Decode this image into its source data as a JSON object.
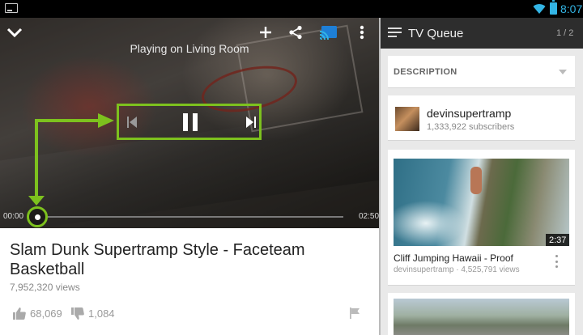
{
  "status_bar": {
    "time": "8:07",
    "accent": "#33b5e5"
  },
  "player": {
    "casting_text": "Playing on Living Room",
    "time_current": "00:00",
    "time_total": "02:50",
    "progress": 0.0,
    "annotation_color": "#7dc11e",
    "icons": {
      "collapse": "chevron-down-icon",
      "add": "plus-icon",
      "share": "share-icon",
      "cast": "cast-icon",
      "more": "more-vert-icon",
      "prev": "skip-previous-icon",
      "pause": "pause-icon",
      "next": "skip-next-icon"
    }
  },
  "video_info": {
    "title": "Slam Dunk Supertramp Style - Faceteam Basketball",
    "views": "7,952,320 views",
    "likes": "68,069",
    "dislikes": "1,084"
  },
  "queue": {
    "title": "TV Queue",
    "count": "1 / 2",
    "description_label": "DESCRIPTION",
    "channel": {
      "name": "devinsupertramp",
      "subscribers": "1,333,922 subscribers"
    },
    "videos": [
      {
        "title": "Cliff Jumping Hawaii - Proof",
        "meta": "devinsupertramp · 4,525,791 views",
        "duration": "2:37"
      }
    ]
  }
}
